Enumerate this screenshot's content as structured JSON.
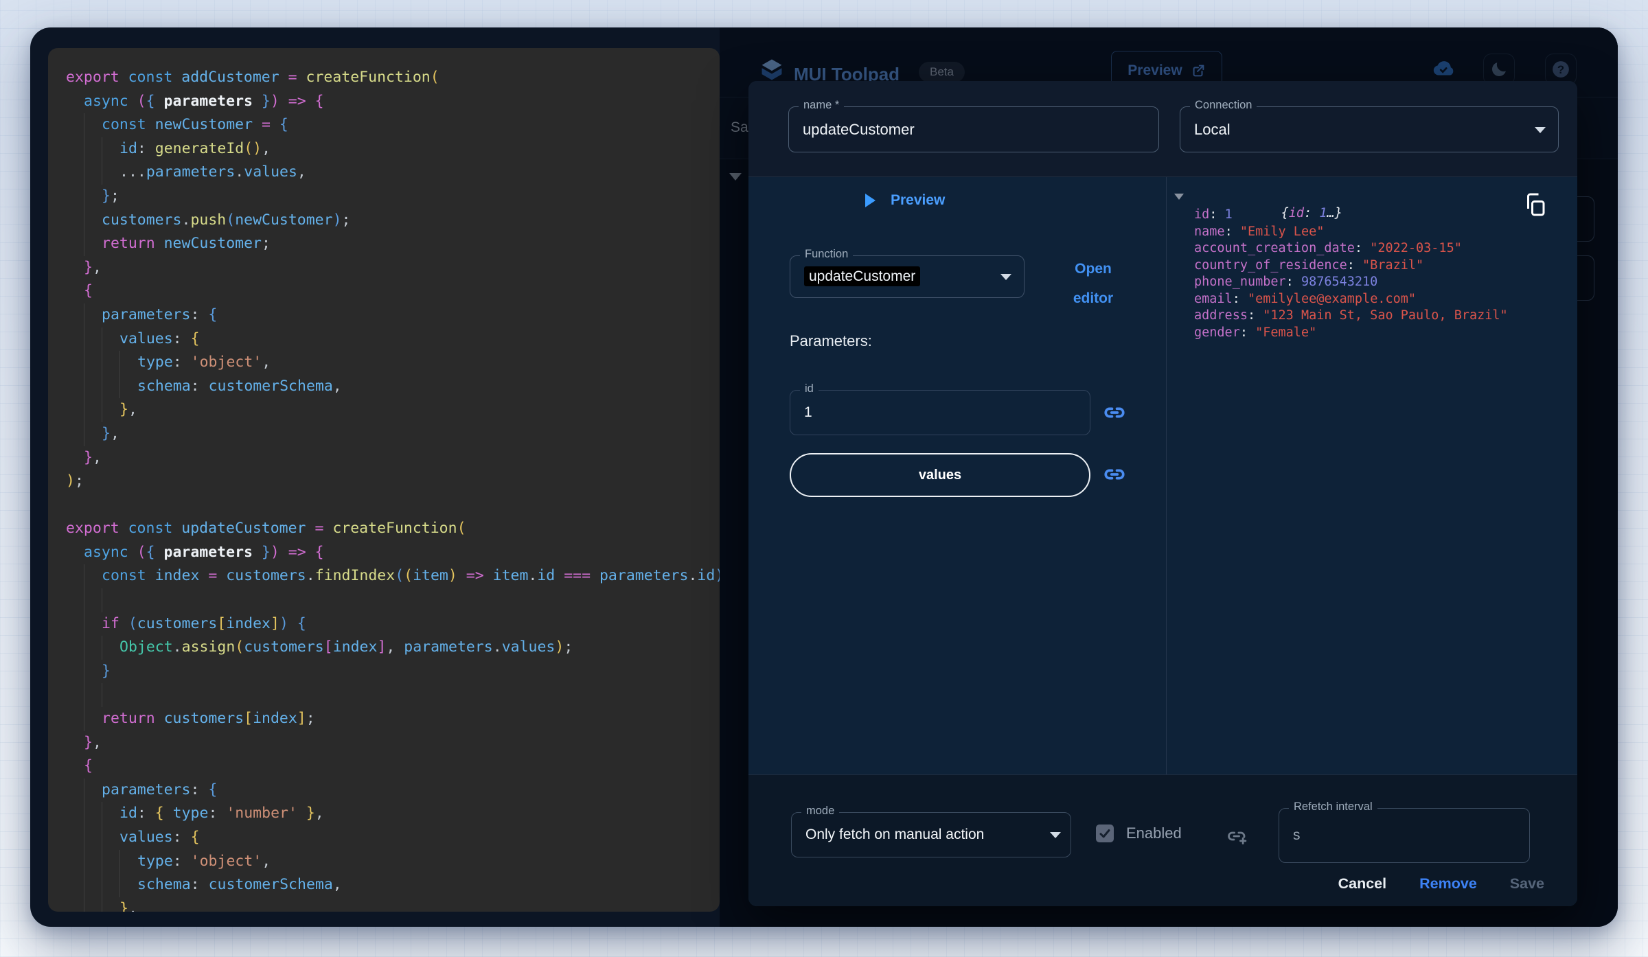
{
  "app_header": {
    "title": "MUI Toolpad",
    "beta": "Beta",
    "preview": "Preview",
    "toolbar_save": "Save"
  },
  "editor": {
    "lines": [
      {
        "i": 0,
        "t": [
          [
            "export ",
            "p"
          ],
          [
            "const ",
            "b"
          ],
          [
            "addCustomer ",
            "i"
          ],
          [
            "= ",
            "p"
          ],
          [
            "createFunction",
            "f"
          ],
          [
            "(",
            "y"
          ]
        ]
      },
      {
        "i": 1,
        "t": [
          [
            "async ",
            "b"
          ],
          [
            "(",
            "m"
          ],
          [
            "{ ",
            "u"
          ],
          [
            "parameters",
            "w"
          ],
          [
            " }",
            "u"
          ],
          [
            ")",
            "m"
          ],
          [
            " ",
            "d"
          ],
          [
            "=> ",
            "p"
          ],
          [
            "{",
            "m"
          ]
        ]
      },
      {
        "i": 2,
        "t": [
          [
            "const ",
            "b"
          ],
          [
            "newCustomer ",
            "i"
          ],
          [
            "= ",
            "p"
          ],
          [
            "{",
            "u"
          ]
        ]
      },
      {
        "i": 3,
        "t": [
          [
            "id",
            "i"
          ],
          [
            ": ",
            "d"
          ],
          [
            "generateId",
            "f"
          ],
          [
            "()",
            "y"
          ],
          [
            ",",
            "d"
          ]
        ]
      },
      {
        "i": 3,
        "t": [
          [
            "...",
            "d"
          ],
          [
            "parameters",
            "i"
          ],
          [
            ".",
            "d"
          ],
          [
            "values",
            "i"
          ],
          [
            ",",
            "d"
          ]
        ]
      },
      {
        "i": 2,
        "t": [
          [
            "}",
            "u"
          ],
          [
            ";",
            "d"
          ]
        ]
      },
      {
        "i": 2,
        "t": [
          [
            "customers",
            "i"
          ],
          [
            ".",
            "d"
          ],
          [
            "push",
            "f"
          ],
          [
            "(",
            "u"
          ],
          [
            "newCustomer",
            "i"
          ],
          [
            ")",
            "u"
          ],
          [
            ";",
            "d"
          ]
        ]
      },
      {
        "i": 2,
        "t": [
          [
            "return ",
            "p"
          ],
          [
            "newCustomer",
            "i"
          ],
          [
            ";",
            "d"
          ]
        ]
      },
      {
        "i": 1,
        "t": [
          [
            "}",
            "m"
          ],
          [
            ",",
            "d"
          ]
        ]
      },
      {
        "i": 1,
        "t": [
          [
            "{",
            "m"
          ]
        ]
      },
      {
        "i": 2,
        "t": [
          [
            "parameters",
            "i"
          ],
          [
            ": ",
            "d"
          ],
          [
            "{",
            "u"
          ]
        ]
      },
      {
        "i": 3,
        "t": [
          [
            "values",
            "i"
          ],
          [
            ": ",
            "d"
          ],
          [
            "{",
            "y"
          ]
        ]
      },
      {
        "i": 4,
        "t": [
          [
            "type",
            "i"
          ],
          [
            ": ",
            "d"
          ],
          [
            "'object'",
            "s"
          ],
          [
            ",",
            "d"
          ]
        ]
      },
      {
        "i": 4,
        "t": [
          [
            "schema",
            "i"
          ],
          [
            ": ",
            "d"
          ],
          [
            "customerSchema",
            "i"
          ],
          [
            ",",
            "d"
          ]
        ]
      },
      {
        "i": 3,
        "t": [
          [
            "}",
            "y"
          ],
          [
            ",",
            "d"
          ]
        ]
      },
      {
        "i": 2,
        "t": [
          [
            "}",
            "u"
          ],
          [
            ",",
            "d"
          ]
        ]
      },
      {
        "i": 1,
        "t": [
          [
            "}",
            "m"
          ],
          [
            ",",
            "d"
          ]
        ]
      },
      {
        "i": 0,
        "t": [
          [
            ")",
            "y"
          ],
          [
            ";",
            "d"
          ]
        ]
      },
      {
        "i": 0,
        "t": []
      },
      {
        "i": 0,
        "t": [
          [
            "export ",
            "p"
          ],
          [
            "const ",
            "b"
          ],
          [
            "updateCustomer ",
            "i"
          ],
          [
            "= ",
            "p"
          ],
          [
            "createFunction",
            "f"
          ],
          [
            "(",
            "y"
          ]
        ]
      },
      {
        "i": 1,
        "t": [
          [
            "async ",
            "b"
          ],
          [
            "(",
            "m"
          ],
          [
            "{ ",
            "u"
          ],
          [
            "parameters",
            "w"
          ],
          [
            " }",
            "u"
          ],
          [
            ")",
            "m"
          ],
          [
            " ",
            "d"
          ],
          [
            "=> ",
            "p"
          ],
          [
            "{",
            "m"
          ]
        ]
      },
      {
        "i": 2,
        "t": [
          [
            "const ",
            "b"
          ],
          [
            "index ",
            "i"
          ],
          [
            "= ",
            "p"
          ],
          [
            "customers",
            "i"
          ],
          [
            ".",
            "d"
          ],
          [
            "findIndex",
            "f"
          ],
          [
            "(",
            "u"
          ],
          [
            "(",
            "y"
          ],
          [
            "item",
            "i"
          ],
          [
            ")",
            "y"
          ],
          [
            " ",
            "d"
          ],
          [
            "=> ",
            "p"
          ],
          [
            "item",
            "i"
          ],
          [
            ".",
            "d"
          ],
          [
            "id ",
            "i"
          ],
          [
            "=== ",
            "p"
          ],
          [
            "parameters",
            "i"
          ],
          [
            ".",
            "d"
          ],
          [
            "id",
            "i"
          ],
          [
            ")",
            "u"
          ],
          [
            ";",
            "d"
          ]
        ]
      },
      {
        "i": 3,
        "t": []
      },
      {
        "i": 2,
        "t": [
          [
            "if ",
            "p"
          ],
          [
            "(",
            "u"
          ],
          [
            "customers",
            "i"
          ],
          [
            "[",
            "y"
          ],
          [
            "index",
            "i"
          ],
          [
            "]",
            "y"
          ],
          [
            ")",
            "u"
          ],
          [
            " ",
            "d"
          ],
          [
            "{",
            "u"
          ]
        ]
      },
      {
        "i": 3,
        "t": [
          [
            "Object",
            "t"
          ],
          [
            ".",
            "d"
          ],
          [
            "assign",
            "f"
          ],
          [
            "(",
            "y"
          ],
          [
            "customers",
            "i"
          ],
          [
            "[",
            "m"
          ],
          [
            "index",
            "i"
          ],
          [
            "]",
            "m"
          ],
          [
            ", ",
            "d"
          ],
          [
            "parameters",
            "i"
          ],
          [
            ".",
            "d"
          ],
          [
            "values",
            "i"
          ],
          [
            ")",
            "y"
          ],
          [
            ";",
            "d"
          ]
        ]
      },
      {
        "i": 2,
        "t": [
          [
            "}",
            "u"
          ]
        ]
      },
      {
        "i": 3,
        "t": []
      },
      {
        "i": 2,
        "t": [
          [
            "return ",
            "p"
          ],
          [
            "customers",
            "i"
          ],
          [
            "[",
            "y"
          ],
          [
            "index",
            "i"
          ],
          [
            "]",
            "y"
          ],
          [
            ";",
            "d"
          ]
        ]
      },
      {
        "i": 1,
        "t": [
          [
            "}",
            "m"
          ],
          [
            ",",
            "d"
          ]
        ]
      },
      {
        "i": 1,
        "t": [
          [
            "{",
            "m"
          ]
        ]
      },
      {
        "i": 2,
        "t": [
          [
            "parameters",
            "i"
          ],
          [
            ": ",
            "d"
          ],
          [
            "{",
            "u"
          ]
        ]
      },
      {
        "i": 3,
        "t": [
          [
            "id",
            "i"
          ],
          [
            ": ",
            "d"
          ],
          [
            "{ ",
            "y"
          ],
          [
            "type",
            "i"
          ],
          [
            ": ",
            "d"
          ],
          [
            "'number'",
            "s"
          ],
          [
            " }",
            "y"
          ],
          [
            ",",
            "d"
          ]
        ]
      },
      {
        "i": 3,
        "t": [
          [
            "values",
            "i"
          ],
          [
            ": ",
            "d"
          ],
          [
            "{",
            "y"
          ]
        ]
      },
      {
        "i": 4,
        "t": [
          [
            "type",
            "i"
          ],
          [
            ": ",
            "d"
          ],
          [
            "'object'",
            "s"
          ],
          [
            ",",
            "d"
          ]
        ]
      },
      {
        "i": 4,
        "t": [
          [
            "schema",
            "i"
          ],
          [
            ": ",
            "d"
          ],
          [
            "customerSchema",
            "i"
          ],
          [
            ",",
            "d"
          ]
        ]
      },
      {
        "i": 3,
        "t": [
          [
            "}",
            "y"
          ],
          [
            ",",
            "d"
          ]
        ]
      }
    ]
  },
  "dialog": {
    "name_field": {
      "label": "name *",
      "value": "updateCustomer"
    },
    "connection": {
      "label": "Connection",
      "value": "Local"
    },
    "preview_toggle": "Preview",
    "function_select": {
      "label": "Function",
      "value": "updateCustomer"
    },
    "open_editor": "Open editor",
    "parameters_heading": "Parameters:",
    "id_field": {
      "label": "id",
      "value": "1"
    },
    "values_button": "values",
    "result": {
      "summary_parts": [
        "{",
        "id",
        ": ",
        "1",
        "…}"
      ],
      "entries": [
        {
          "k": "id",
          "v": "1",
          "t": "num"
        },
        {
          "k": "name",
          "v": "\"Emily Lee\"",
          "t": "str"
        },
        {
          "k": "account_creation_date",
          "v": "\"2022-03-15\"",
          "t": "str"
        },
        {
          "k": "country_of_residence",
          "v": "\"Brazil\"",
          "t": "str"
        },
        {
          "k": "phone_number",
          "v": "9876543210",
          "t": "num"
        },
        {
          "k": "email",
          "v": "\"emilylee@example.com\"",
          "t": "str"
        },
        {
          "k": "address",
          "v": "\"123 Main St, Sao Paulo, Brazil\"",
          "t": "str"
        },
        {
          "k": "gender",
          "v": "\"Female\"",
          "t": "str"
        }
      ]
    },
    "mode": {
      "label": "mode",
      "value": "Only fetch on manual action"
    },
    "enabled_label": "Enabled",
    "refetch": {
      "label": "Refetch interval",
      "value": "s"
    },
    "buttons": {
      "cancel": "Cancel",
      "remove": "Remove",
      "save": "Save"
    }
  },
  "icons": {
    "logo": "toolpad-layers",
    "sync_status": "cloud-check",
    "theme_toggle": "moon",
    "help": "question-circle",
    "preview_external": "external-link",
    "copy": "copy",
    "binding": "link",
    "add_binding": "link-plus",
    "dropdown": "caret-down",
    "result_collapse": "triangle-down",
    "preview_expand": "triangle-right",
    "checkbox_check": "check"
  },
  "colors": {
    "accent_blue": "#3d82f6",
    "link_blue": "#4a8cf0",
    "json_key": "#c471c9",
    "json_string": "#da544b",
    "json_number": "#7d82e0",
    "editor_bg": "#2a2a2a",
    "dialog_content_bg": "#0e2238",
    "window_bg": "#0c1524"
  }
}
